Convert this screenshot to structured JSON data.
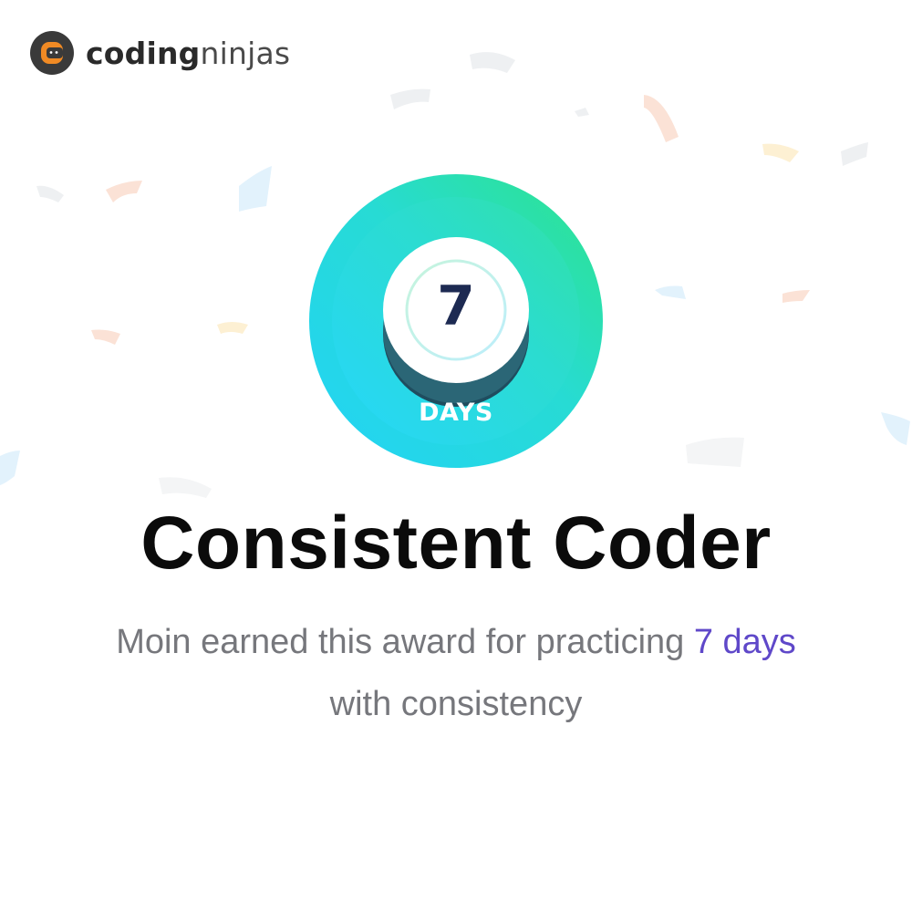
{
  "brand": {
    "name_part1": "coding",
    "name_part2": "ninjas",
    "logo_icon": "coding-ninjas-logo-icon",
    "colors": {
      "orange": "#f08a24",
      "dark": "#3a3a3a"
    }
  },
  "badge": {
    "number": "7",
    "unit": "DAYS",
    "colors": {
      "cyan": "#22d3f7",
      "green": "#2ee48a",
      "navy": "#1d2a52"
    }
  },
  "award": {
    "title": "Consistent Coder",
    "description_before": "Moin earned this award for practicing ",
    "description_highlight": "7 days",
    "description_after": "with consistency",
    "highlight_color": "#5f48c9",
    "text_color": "#76777c"
  }
}
